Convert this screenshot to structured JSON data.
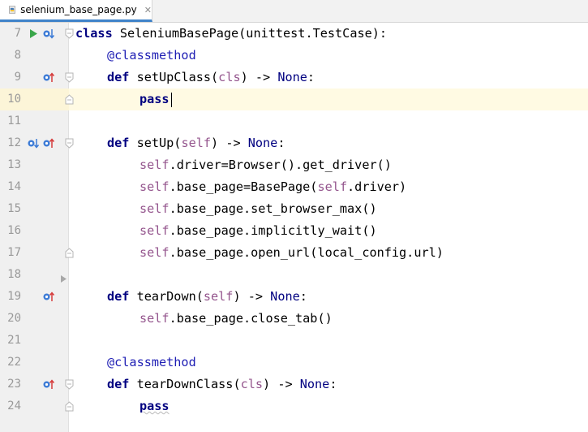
{
  "tab": {
    "filename": "selenium_base_page.py",
    "close_glyph": "✕"
  },
  "colors": {
    "keyword": "#000080",
    "self": "#94558d",
    "decorator": "#1e1eb4",
    "line_number": "#999999",
    "current_line": "#fffae3",
    "tab_underline": "#4083c9",
    "run_arrow": "#3aa64a",
    "override_arrow": "#d63c3c",
    "implement_arrow": "#3c7bd6"
  },
  "lines": [
    {
      "num": "7"
    },
    {
      "num": "8"
    },
    {
      "num": "9"
    },
    {
      "num": "10"
    },
    {
      "num": "11"
    },
    {
      "num": "12"
    },
    {
      "num": "13"
    },
    {
      "num": "14"
    },
    {
      "num": "15"
    },
    {
      "num": "16"
    },
    {
      "num": "17"
    },
    {
      "num": "18"
    },
    {
      "num": "19"
    },
    {
      "num": "20"
    },
    {
      "num": "21"
    },
    {
      "num": "22"
    },
    {
      "num": "23"
    },
    {
      "num": "24"
    }
  ],
  "code": {
    "l7": {
      "kw": "class",
      "text": " SeleniumBasePage(unittest.TestCase):"
    },
    "l8": {
      "decorator": "@classmethod"
    },
    "l9": {
      "kw": "def",
      "name": " setUpClass(",
      "param": "cls",
      "rest": ") -> ",
      "ret": "None",
      "colon": ":"
    },
    "l10": {
      "kw": "pass"
    },
    "l12": {
      "kw": "def",
      "name": " setUp(",
      "param": "self",
      "rest": ") -> ",
      "ret": "None",
      "colon": ":"
    },
    "l13": {
      "self": "self",
      "text": ".driver=Browser().get_driver()"
    },
    "l14": {
      "self": "self",
      "text1": ".base_page=BasePage(",
      "self2": "self",
      "text2": ".driver)"
    },
    "l15": {
      "self": "self",
      "text": ".base_page.set_browser_max()"
    },
    "l16": {
      "self": "self",
      "text": ".base_page.implicitly_wait()"
    },
    "l17": {
      "self": "self",
      "text": ".base_page.open_url(local_config.url)"
    },
    "l19": {
      "kw": "def",
      "name": " tearDown(",
      "param": "self",
      "rest": ") -> ",
      "ret": "None",
      "colon": ":"
    },
    "l20": {
      "self": "self",
      "text": ".base_page.close_tab()"
    },
    "l22": {
      "decorator": "@classmethod"
    },
    "l23": {
      "kw": "def",
      "name": " tearDownClass(",
      "param": "cls",
      "rest": ") -> ",
      "ret": "None",
      "colon": ":"
    },
    "l24": {
      "kw": "pass"
    }
  },
  "gutter_icons": {
    "l7": [
      "run-icon",
      "implemented-down-icon"
    ],
    "l9": [
      "overrides-up-icon"
    ],
    "l12": [
      "implemented-down-icon",
      "overrides-up-icon"
    ],
    "l19": [
      "overrides-up-icon"
    ],
    "l23": [
      "overrides-up-icon"
    ]
  }
}
